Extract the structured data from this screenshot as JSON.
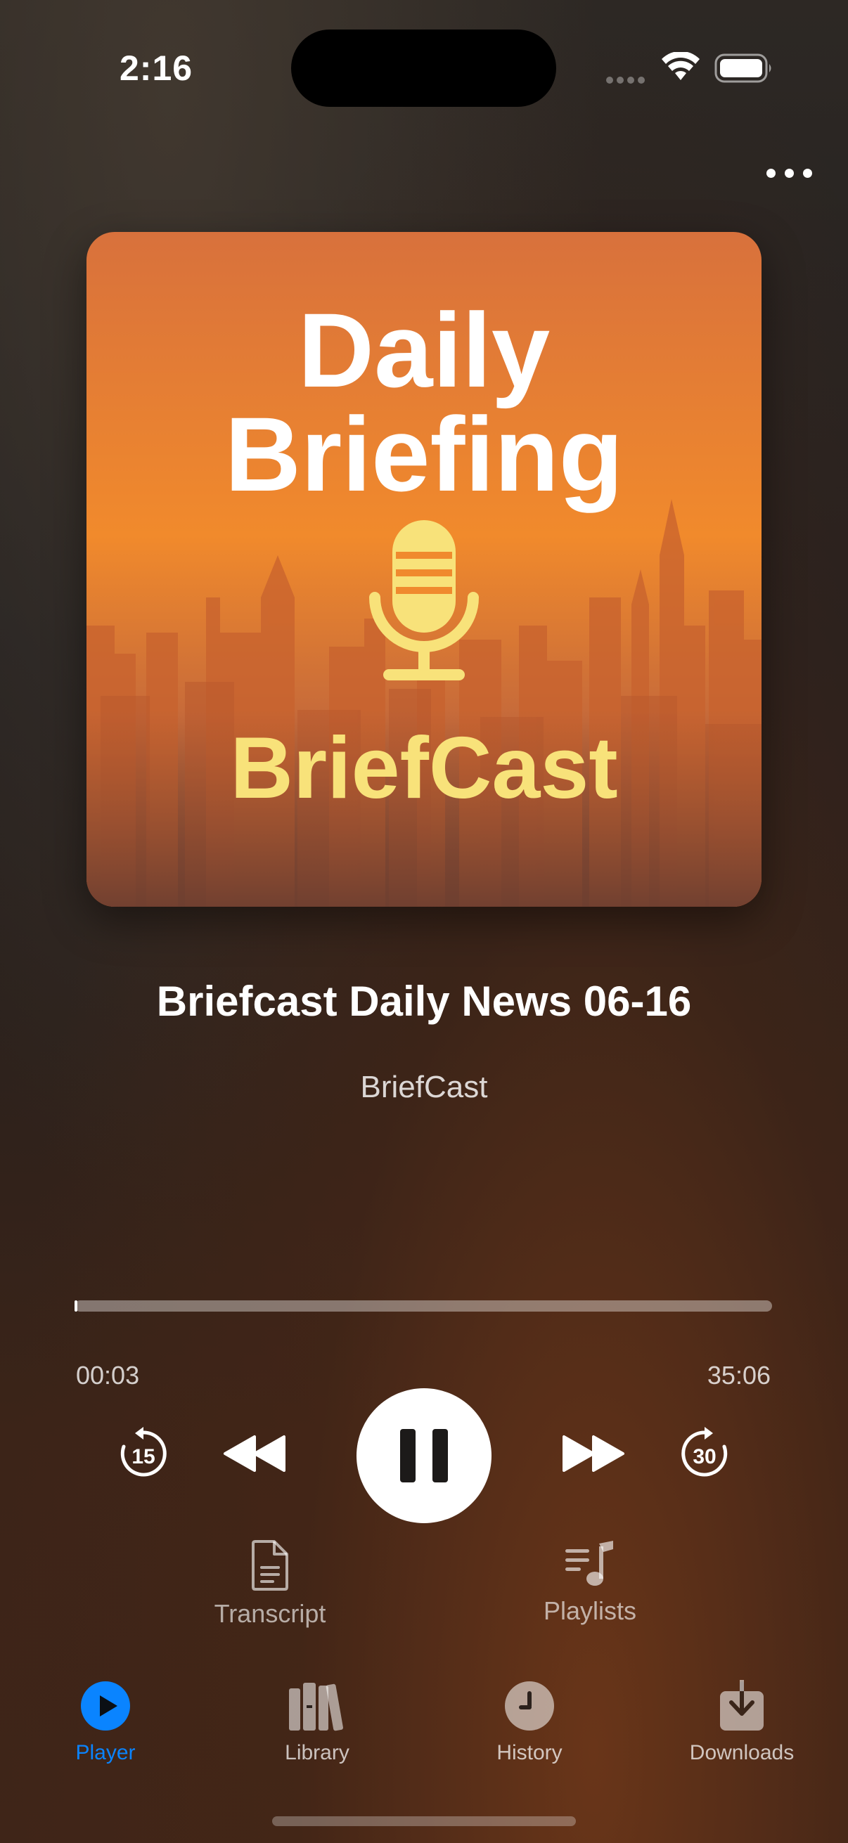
{
  "status_bar": {
    "time": "2:16"
  },
  "artwork": {
    "headline_line1": "Daily",
    "headline_line2": "Briefing",
    "brand": "BriefCast",
    "icon": "microphone-icon"
  },
  "episode": {
    "title": "Briefcast Daily News 06-16",
    "show": "BriefCast"
  },
  "playback": {
    "elapsed": "00:03",
    "total": "35:06",
    "progress_fraction": 0.0014,
    "skip_back_seconds": "15",
    "skip_forward_seconds": "30",
    "state": "playing"
  },
  "actions": {
    "transcript_label": "Transcript",
    "playlists_label": "Playlists"
  },
  "tabs": [
    {
      "label": "Player",
      "icon": "play-circle-icon",
      "active": true
    },
    {
      "label": "Library",
      "icon": "books-icon",
      "active": false
    },
    {
      "label": "History",
      "icon": "clock-icon",
      "active": false
    },
    {
      "label": "Downloads",
      "icon": "download-tray-icon",
      "active": false
    }
  ],
  "colors": {
    "accent": "#0a84ff",
    "artwork_text_yellow": "#f8e27a",
    "artwork_orange": "#e6782e"
  }
}
